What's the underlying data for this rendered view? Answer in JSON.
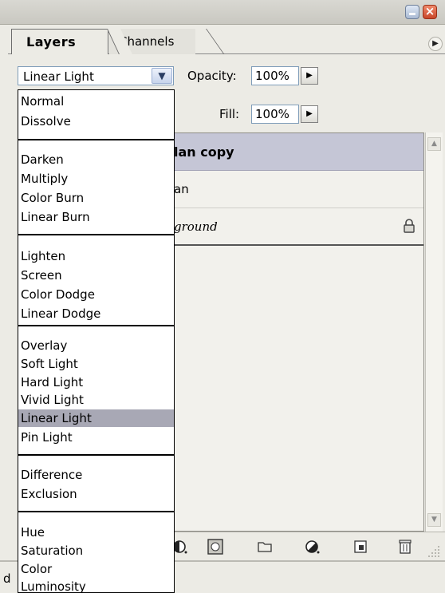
{
  "tabs": {
    "layers": "Layers",
    "channels": "Channels"
  },
  "blend_mode": {
    "selected": "Linear Light",
    "options_groups": [
      [
        "Normal",
        "Dissolve"
      ],
      [
        "Darken",
        "Multiply",
        "Color Burn",
        "Linear Burn"
      ],
      [
        "Lighten",
        "Screen",
        "Color Dodge",
        "Linear Dodge"
      ],
      [
        "Overlay",
        "Soft Light",
        "Hard Light",
        "Vivid Light",
        "Linear Light",
        "Pin Light"
      ],
      [
        "Difference",
        "Exclusion"
      ],
      [
        "Hue",
        "Saturation",
        "Color",
        "Luminosity"
      ]
    ]
  },
  "opacity": {
    "label": "Opacity:",
    "value": "100%"
  },
  "fill": {
    "label": "Fill:",
    "value": "100%"
  },
  "layers": [
    {
      "name": "lan copy",
      "selected": true
    },
    {
      "name": "an",
      "selected": false
    },
    {
      "name": "ground",
      "italic": true,
      "locked": true
    }
  ],
  "left_edge_fragment": "d",
  "icons": {
    "minimize": "minimize-icon",
    "close": "close-icon",
    "panel_menu": "panel-menu-icon",
    "lock": "lock-icon",
    "toolbar": [
      "layer-style-icon",
      "add-mask-icon",
      "new-group-icon",
      "adjustment-layer-icon",
      "new-layer-icon",
      "trash-icon"
    ]
  },
  "colors": {
    "panel_bg": "#ecebe5",
    "selected_layer": "#c5c6d6",
    "selected_dropdown_item": "#a8a8b5"
  }
}
